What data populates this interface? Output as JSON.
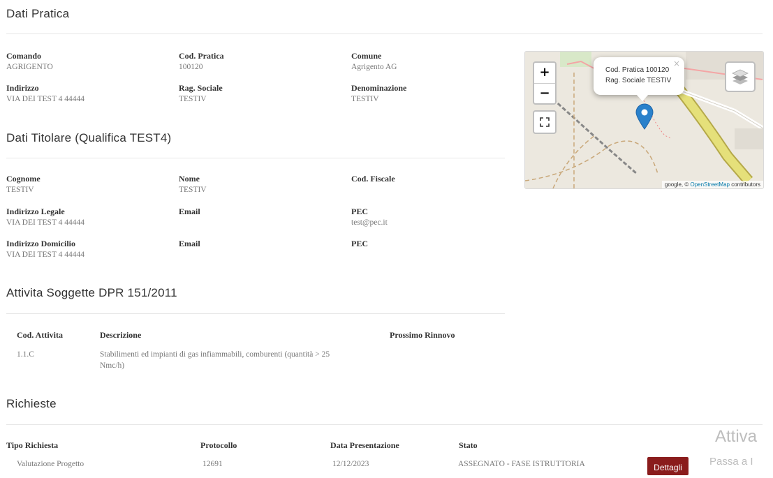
{
  "pratica": {
    "title": "Dati Pratica",
    "fields": [
      {
        "label": "Comando",
        "value": "AGRIGENTO"
      },
      {
        "label": "Cod. Pratica",
        "value": "100120"
      },
      {
        "label": "Comune",
        "value": "Agrigento AG"
      },
      {
        "label": "Indirizzo",
        "value": "VIA DEI TEST 4 44444"
      },
      {
        "label": "Rag. Sociale",
        "value": "TESTIV"
      },
      {
        "label": "Denominazione",
        "value": "TESTIV"
      }
    ]
  },
  "map": {
    "zoom_in": "+",
    "zoom_out": "−",
    "fullscreen_icon": "fullscreen-icon",
    "layers_icon": "layers-icon",
    "popup_line1": "Cod. Pratica 100120",
    "popup_line2": "Rag. Sociale TESTIV",
    "popup_close": "×",
    "attribution_prefix": "google, ©",
    "attribution_link": "OpenStreetMap",
    "attribution_suffix": "contributors",
    "marker_color": "#2a81cb"
  },
  "titolare": {
    "title": "Dati Titolare (Qualifica TEST4)",
    "fields": [
      {
        "label": "Cognome",
        "value": "TESTIV"
      },
      {
        "label": "Nome",
        "value": "TESTIV"
      },
      {
        "label": "Cod. Fiscale",
        "value": ""
      },
      {
        "label": "Indirizzo Legale",
        "value": "VIA DEI TEST 4 44444"
      },
      {
        "label": "Email",
        "value": ""
      },
      {
        "label": "PEC",
        "value": "test@pec.it"
      },
      {
        "label": "Indirizzo Domicilio",
        "value": "VIA DEI TEST 4 44444"
      },
      {
        "label": "Email",
        "value": ""
      },
      {
        "label": "PEC",
        "value": ""
      }
    ]
  },
  "attivita": {
    "title": "Attivita Soggette DPR 151/2011",
    "headers": [
      "Cod. Attivita",
      "Descrizione",
      "Prossimo Rinnovo"
    ],
    "rows": [
      {
        "cod": "1.1.C",
        "descr_line1": "Stabilimenti ed impianti di gas infiammabili, comburenti (quantità > 25",
        "descr_line2": "Nmc/h)",
        "rinnovo": ""
      }
    ]
  },
  "richieste": {
    "title": "Richieste",
    "headers": [
      "Tipo Richiesta",
      "Protocollo",
      "Data Presentazione",
      "Stato"
    ],
    "rows": [
      {
        "tipo": "Valutazione Progetto",
        "protocollo": "12691",
        "data": "12/12/2023",
        "stato": "ASSEGNATO - FASE ISTRUTTORIA",
        "action": "Dettagli"
      }
    ]
  },
  "watermark": {
    "line1": "Attiva",
    "line2": "Passa a I"
  },
  "colors": {
    "button_bg": "#8a1c1c",
    "osm_link": "#0078a8"
  }
}
